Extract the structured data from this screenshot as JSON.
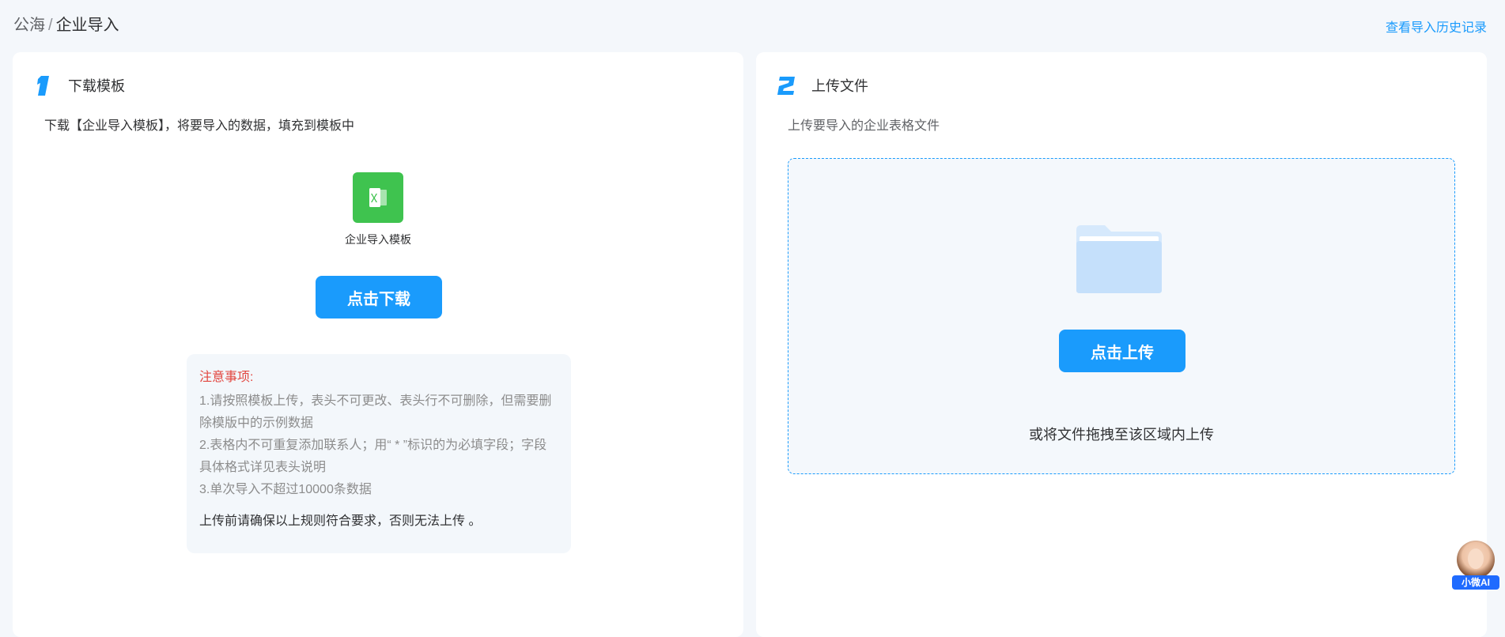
{
  "breadcrumb": {
    "parent": "公海",
    "separator": "/",
    "current": "企业导入"
  },
  "header": {
    "history_link": "查看导入历史记录"
  },
  "step1": {
    "title": "下载模板",
    "description": "下载【企业导入模板】，将要导入的数据，填充到模板中",
    "template_icon": "excel-file-icon",
    "template_name": "企业导入模板",
    "download_button": "点击下载",
    "notice": {
      "title": "注意事项:",
      "lines": [
        "1.请按照模板上传，表头不可更改、表头行不可删除，但需要删",
        "除模版中的示例数据",
        "2.表格内不可重复添加联系人；用“ * ”标识的为必填字段；字段",
        "具体格式详见表头说明",
        "3.单次导入不超过10000条数据"
      ],
      "footer": "上传前请确保以上规则符合要求，否则无法上传 。"
    }
  },
  "step2": {
    "title": "上传文件",
    "description": "上传要导入的企业表格文件",
    "folder_icon": "folder-icon",
    "upload_button": "点击上传",
    "drop_hint": "或将文件拖拽至该区域内上传"
  },
  "assistant": {
    "label": "小微AI"
  },
  "colors": {
    "primary": "#1a9bfc",
    "excel_green": "#3fc34f",
    "notice_title": "#e2463f",
    "folder": "#c5e0fb"
  }
}
